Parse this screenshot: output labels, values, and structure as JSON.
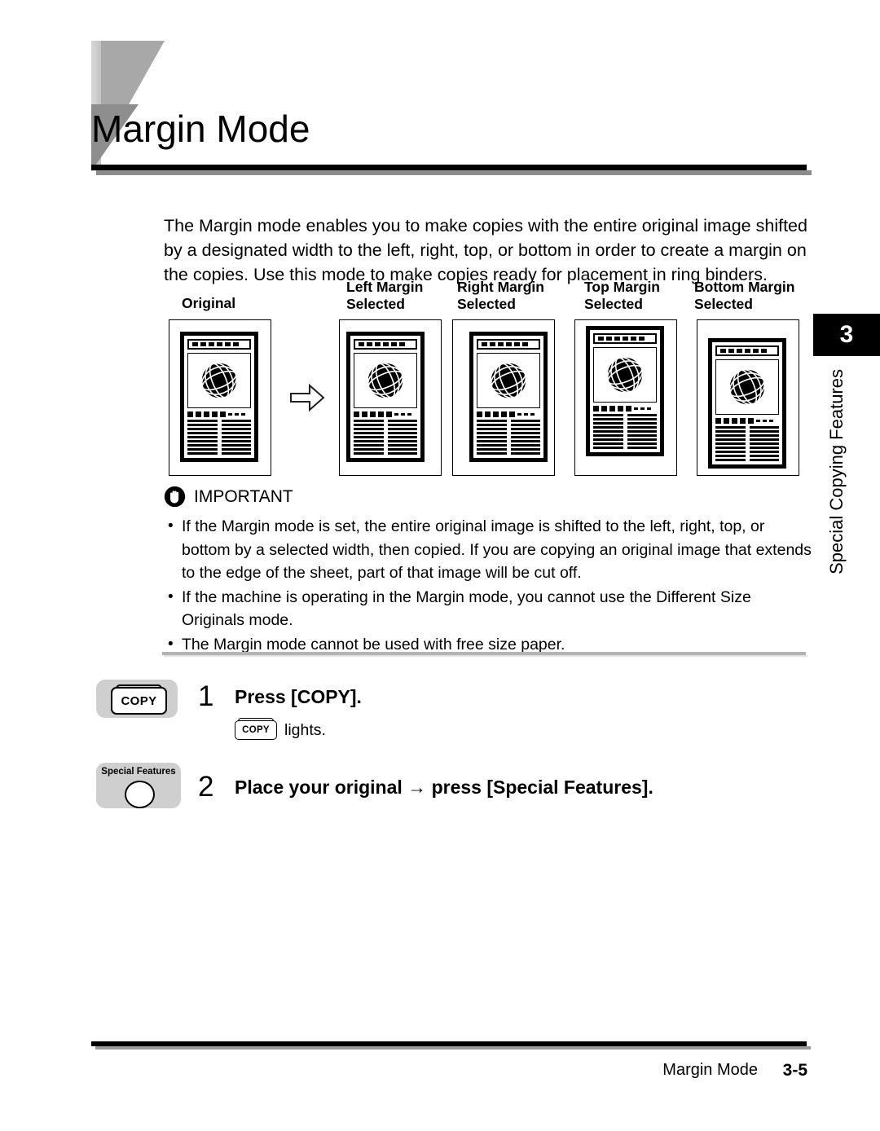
{
  "header": {
    "title": "Margin Mode"
  },
  "side_tab": {
    "chapter_number": "3",
    "chapter_label": "Special Copying Features"
  },
  "intro": {
    "paragraph": "The Margin mode enables you to make copies with the entire original image shifted by a designated width to the left, right, top, or bottom in order to create a margin on the copies. Use this mode to make copies ready for placement in ring binders."
  },
  "diagram": {
    "original_label": "Original",
    "arrow_icon": "right-arrow-icon",
    "columns": [
      {
        "line1": "Left Margin",
        "line2": "Selected",
        "shift": "left"
      },
      {
        "line1": "Right Margin",
        "line2": "Selected",
        "shift": "right"
      },
      {
        "line1": "Top Margin",
        "line2": "Selected",
        "shift": "top"
      },
      {
        "line1": "Bottom Margin",
        "line2": "Selected",
        "shift": "bottom"
      }
    ]
  },
  "important": {
    "icon": "hand-stop-icon",
    "title": "IMPORTANT",
    "bullets": [
      "If the Margin mode is set, the entire original image is shifted to the left, right, top, or bottom by a selected width, then copied. If you are copying an original image that extends to the edge of the sheet, part of that image will be cut off.",
      "If the machine is operating in the Margin mode, you cannot use the Different Size Originals mode.",
      "The Margin mode cannot be used with free size paper."
    ]
  },
  "steps": [
    {
      "number": "1",
      "title": "Press [COPY].",
      "key_label": "COPY",
      "sub_key_label": "COPY",
      "sub_text": "lights."
    },
    {
      "number": "2",
      "title": "Place your original → press [Special Features].",
      "key_label": "Special Features"
    }
  ],
  "footer": {
    "title": "Margin Mode",
    "page": "3-5"
  },
  "colors": {
    "accent_gray": "#a8a8a8",
    "badge_gray": "#cfcfcf",
    "rule_black": "#000000"
  }
}
